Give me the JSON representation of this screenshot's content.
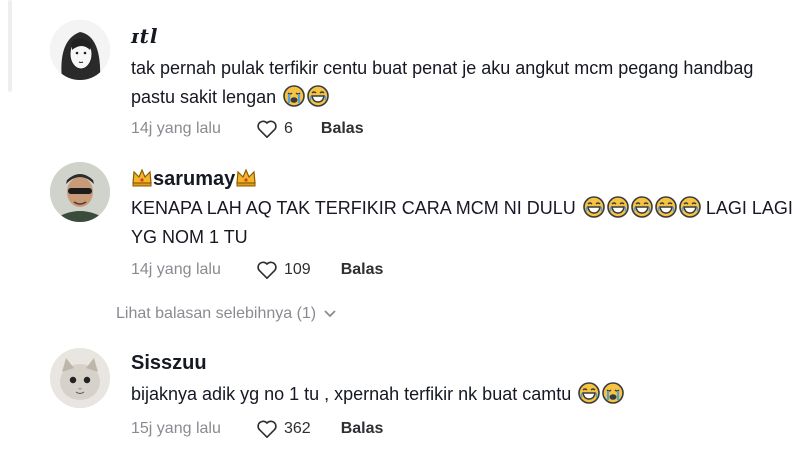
{
  "comments": [
    {
      "username": "ɪtl",
      "text": "tak pernah pulak terfikir centu buat penat je aku angkut mcm pegang handbag pastu sakit lengan",
      "emojis": [
        "crying-face",
        "laughing-face"
      ],
      "time": "14j yang lalu",
      "likes": "6",
      "reply_label": "Balas"
    },
    {
      "username": "sarumay",
      "username_emojis": [
        "crown",
        "crown"
      ],
      "text_a": "KENAPA LAH AQ TAK TERFIKIR CARA MCM NI DULU",
      "emojis": [
        "laughing-face",
        "laughing-face",
        "laughing-face",
        "laughing-face",
        "laughing-face"
      ],
      "text_b": "LAGI LAGI YG NOM 1 TU",
      "time": "14j yang lalu",
      "likes": "109",
      "reply_label": "Balas"
    },
    {
      "username": "Sisszuu",
      "text": "bijaknya adik yg no 1 tu , xpernah terfikir nk buat camtu",
      "emojis": [
        "laughing-face",
        "crying-face"
      ],
      "time": "15j yang lalu",
      "likes": "362",
      "reply_label": "Balas"
    }
  ],
  "view_more": {
    "label": "Lihat balasan selebihnya (1)"
  }
}
